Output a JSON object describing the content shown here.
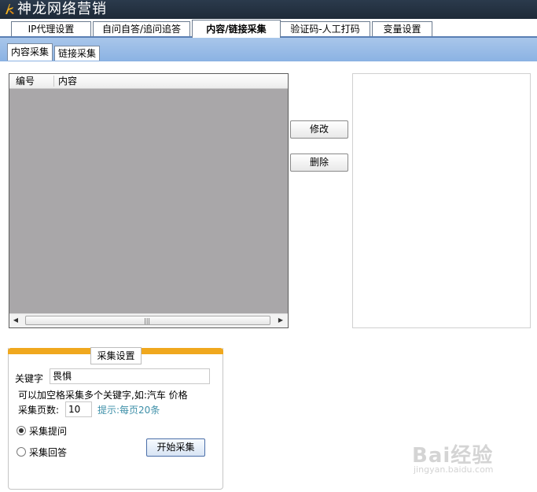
{
  "window": {
    "title": "神龙网络营销"
  },
  "tabs": [
    {
      "label": "IP代理设置",
      "active": false
    },
    {
      "label": "自问自答/追问追答",
      "active": false
    },
    {
      "label": "内容/链接采集",
      "active": true
    },
    {
      "label": "验证码-人工打码",
      "active": false
    },
    {
      "label": "变量设置",
      "active": false
    }
  ],
  "subtabs": [
    {
      "label": "内容采集",
      "active": true
    },
    {
      "label": "链接采集",
      "active": false
    }
  ],
  "list": {
    "columns": [
      "编号",
      "内容"
    ],
    "rows": []
  },
  "buttons": {
    "edit_label": "修改",
    "delete_label": "删除",
    "start_label": "开始采集"
  },
  "collect_settings": {
    "group_title": "采集设置",
    "keyword_label": "关键字",
    "keyword_value": "畏惧",
    "multi_keyword_hint": "可以加空格采集多个关键字,如:汽车    价格",
    "pages_label": "采集页数:",
    "pages_value": "10",
    "pages_hint": "提示:每页20条",
    "radio_options": [
      {
        "label": "采集提问",
        "checked": true
      },
      {
        "label": "采集回答",
        "checked": false
      }
    ]
  },
  "watermark": {
    "text": "Bai经验",
    "sub": "jingyan.baidu.com"
  },
  "colors": {
    "accent_orange": "#f0a81e",
    "band_blue": "#9bbde7",
    "list_bg": "#a9a7a9"
  }
}
